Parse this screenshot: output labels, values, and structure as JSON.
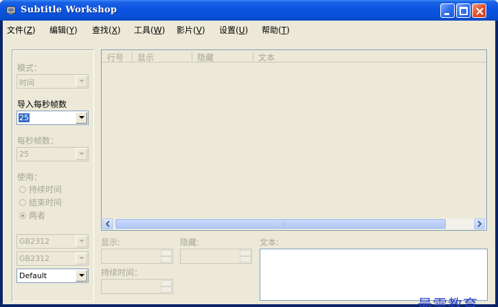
{
  "window": {
    "title": "Subtitle Workshop"
  },
  "menu": [
    {
      "label": "文件(",
      "acc": "Z",
      "end": ")"
    },
    {
      "label": "编辑(",
      "acc": "Y",
      "end": ")"
    },
    {
      "label": "查找(",
      "acc": "X",
      "end": ")"
    },
    {
      "label": "工具(",
      "acc": "W",
      "end": ")"
    },
    {
      "label": "影片(",
      "acc": "V",
      "end": ")"
    },
    {
      "label": "设置(",
      "acc": "U",
      "end": ")"
    },
    {
      "label": "帮助(",
      "acc": "T",
      "end": ")"
    }
  ],
  "sidebar": {
    "mode_label": "模式：",
    "mode_value": "时间",
    "import_fps_label": "导入每秒帧数",
    "import_fps_value": "25",
    "fps_label": "每秒帧数：",
    "fps_value": "25",
    "use_label": "使用：",
    "radio_duration": "持续时间",
    "radio_end": "结束时间",
    "radio_both": "两者",
    "radio_selected": "两者",
    "encoding1": "GB2312",
    "encoding2": "GB2312",
    "style_value": "Default"
  },
  "grid": {
    "columns": [
      "行号",
      "显示",
      "隐藏",
      "文本"
    ]
  },
  "editor": {
    "show_label": "显示:",
    "hide_label": "隐藏:",
    "duration_label": "持续时间：",
    "text_label": "文本:"
  },
  "watermark": "最需教育"
}
